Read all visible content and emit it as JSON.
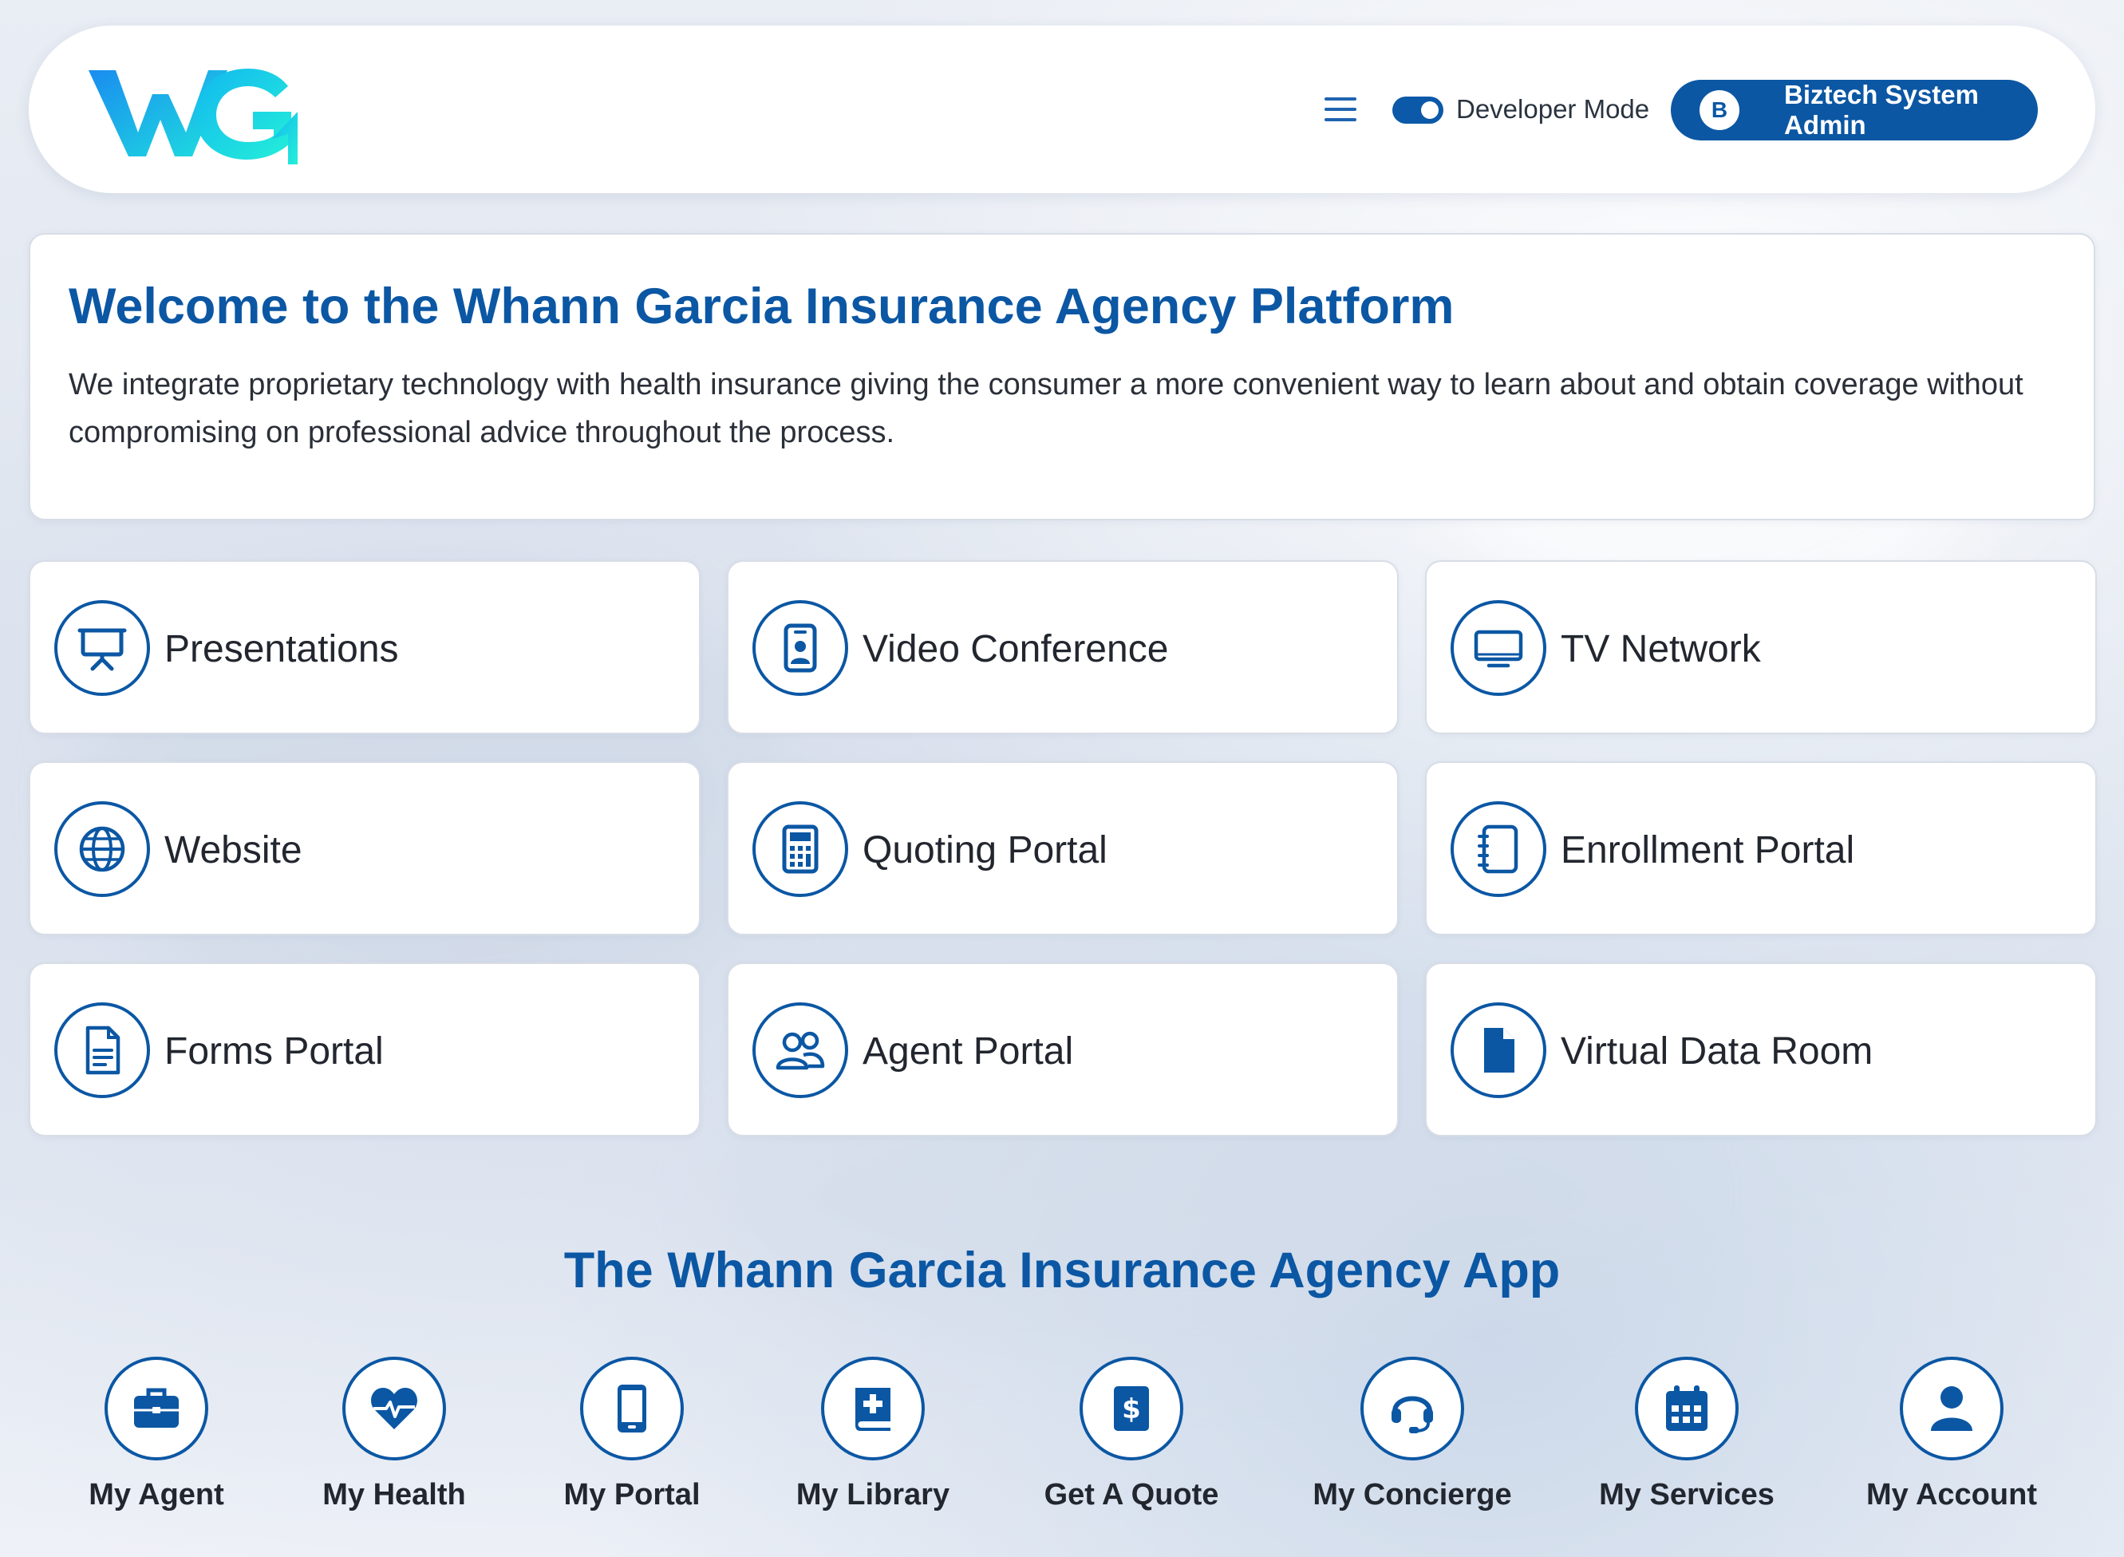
{
  "header": {
    "logo_text": "WG",
    "developer_mode_label": "Developer Mode",
    "developer_mode_on": true,
    "user_initial": "B",
    "user_name": "Biztech System Admin"
  },
  "welcome": {
    "title": "Welcome to the Whann Garcia Insurance Agency Platform",
    "description": "We integrate proprietary technology with health insurance giving the consumer a more convenient way to learn about and obtain coverage without compromising on professional advice throughout the process."
  },
  "tiles": [
    {
      "label": "Presentations",
      "icon": "presentation-icon"
    },
    {
      "label": "Video Conference",
      "icon": "video-conference-icon"
    },
    {
      "label": "TV Network",
      "icon": "tv-icon"
    },
    {
      "label": "Website",
      "icon": "globe-icon"
    },
    {
      "label": "Quoting Portal",
      "icon": "calculator-icon"
    },
    {
      "label": "Enrollment Portal",
      "icon": "notebook-icon"
    },
    {
      "label": "Forms Portal",
      "icon": "document-icon"
    },
    {
      "label": "Agent Portal",
      "icon": "people-icon"
    },
    {
      "label": "Virtual Data Room",
      "icon": "file-icon"
    }
  ],
  "app": {
    "title": "The Whann Garcia Insurance Agency App",
    "items": [
      {
        "label": "My Agent",
        "icon": "briefcase-icon"
      },
      {
        "label": "My Health",
        "icon": "heartbeat-icon"
      },
      {
        "label": "My Portal",
        "icon": "mobile-icon"
      },
      {
        "label": "My Library",
        "icon": "book-icon"
      },
      {
        "label": "Get A Quote",
        "icon": "dollar-icon"
      },
      {
        "label": "My Concierge",
        "icon": "headset-icon"
      },
      {
        "label": "My Services",
        "icon": "calendar-icon"
      },
      {
        "label": "My Account",
        "icon": "user-icon"
      }
    ]
  },
  "colors": {
    "primary": "#0b57a4",
    "logo_gradient_start": "#1e90ff",
    "logo_gradient_end": "#22e3e0"
  }
}
